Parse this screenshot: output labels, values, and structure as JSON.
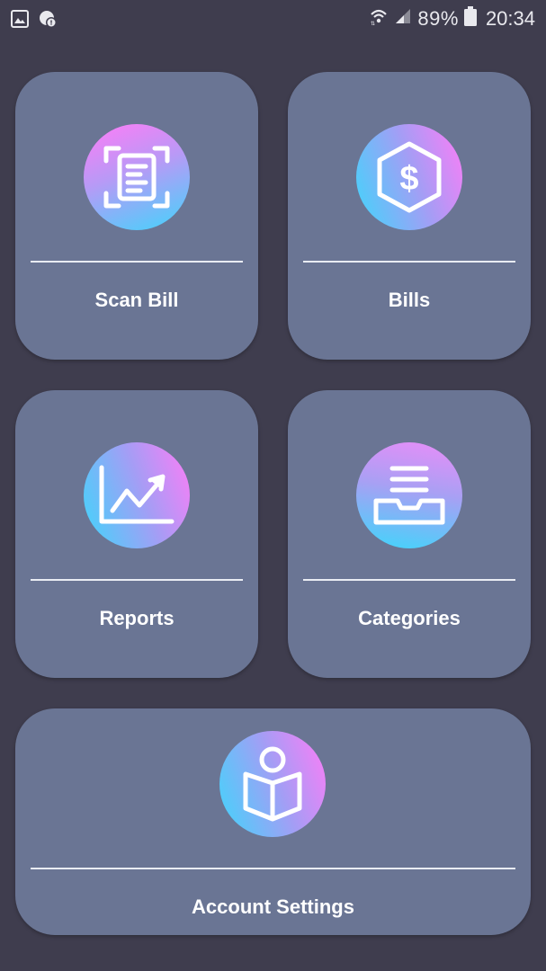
{
  "status_bar": {
    "battery": "89%",
    "time": "20:34",
    "left_icons": [
      "gallery-icon",
      "chat-notification-icon"
    ],
    "right_icons": [
      "wifi-icon",
      "signal-icon",
      "battery-icon"
    ]
  },
  "tiles": {
    "scan_bill": {
      "label": "Scan Bill",
      "icon": "scan-document-icon"
    },
    "bills": {
      "label": "Bills",
      "icon": "dollar-hexagon-icon"
    },
    "reports": {
      "label": "Reports",
      "icon": "chart-trend-icon"
    },
    "categories": {
      "label": "Categories",
      "icon": "inbox-tray-icon"
    },
    "account_settings": {
      "label": "Account Settings",
      "icon": "reader-person-icon"
    }
  },
  "colors": {
    "background": "#3f3d4e",
    "card": "#6a7594",
    "gradient_pink": "#ff7cf7",
    "gradient_blue": "#3fd6fb"
  }
}
